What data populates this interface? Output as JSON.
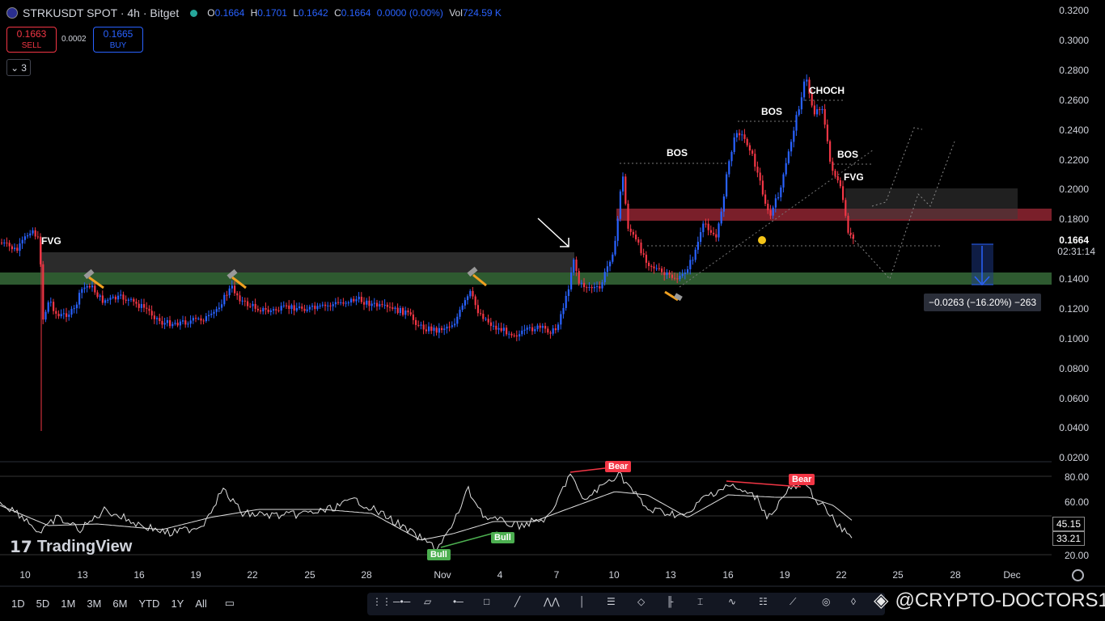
{
  "header": {
    "symbol_title": "STRKUSDT SPOT · 4h · Bitget",
    "open_label": "O",
    "open": "0.1664",
    "high_label": "H",
    "high": "0.1701",
    "low_label": "L",
    "low": "0.1642",
    "close_label": "C",
    "close": "0.1664",
    "change": "0.0000 (0.00%)",
    "vol_label": "Vol",
    "vol": "724.59 K"
  },
  "trade": {
    "sell_price": "0.1663",
    "sell_label": "SELL",
    "spread": "0.0002",
    "buy_price": "0.1665",
    "buy_label": "BUY",
    "indicators_count": "3"
  },
  "price_axis": [
    "0.3200",
    "0.3000",
    "0.2800",
    "0.2600",
    "0.2400",
    "0.2200",
    "0.2000",
    "0.1800",
    "0.1664",
    "0.1400",
    "0.1200",
    "0.1000",
    "0.0800",
    "0.0600",
    "0.0400",
    "0.0200"
  ],
  "current_price": "0.1664",
  "countdown": "02:31:14",
  "rsi_axis": [
    "80.00",
    "60.00",
    "20.00"
  ],
  "rsi_tags": {
    "ma": "45.15",
    "rsi": "33.21"
  },
  "time_axis": [
    "10",
    "13",
    "16",
    "19",
    "22",
    "25",
    "28",
    "Nov",
    "4",
    "7",
    "10",
    "13",
    "16",
    "19",
    "22",
    "25",
    "28",
    "Dec"
  ],
  "annotations": {
    "fvg_left": "FVG",
    "bos1": "BOS",
    "bos2": "BOS",
    "choch": "CHOCH",
    "bos3": "BOS",
    "fvg_right": "FVG",
    "measure": "−0.0263 (−16.20%) −263"
  },
  "rsi_badges": {
    "bear1": "Bear",
    "bear2": "Bear",
    "bull1": "Bull",
    "bull2": "Bull"
  },
  "bottom_toolbar": {
    "timeframes": [
      "1D",
      "5D",
      "1M",
      "3M",
      "6M",
      "YTD",
      "1Y",
      "All"
    ]
  },
  "brand": "TradingView",
  "watermark": "@CRYPTO-DOCTORS1",
  "colors": {
    "up": "#2962ff",
    "down": "#f23645",
    "green_zone": "#2e6b35",
    "red_zone": "#8b2030",
    "bear": "#f23645",
    "bull": "#4caf50"
  }
}
